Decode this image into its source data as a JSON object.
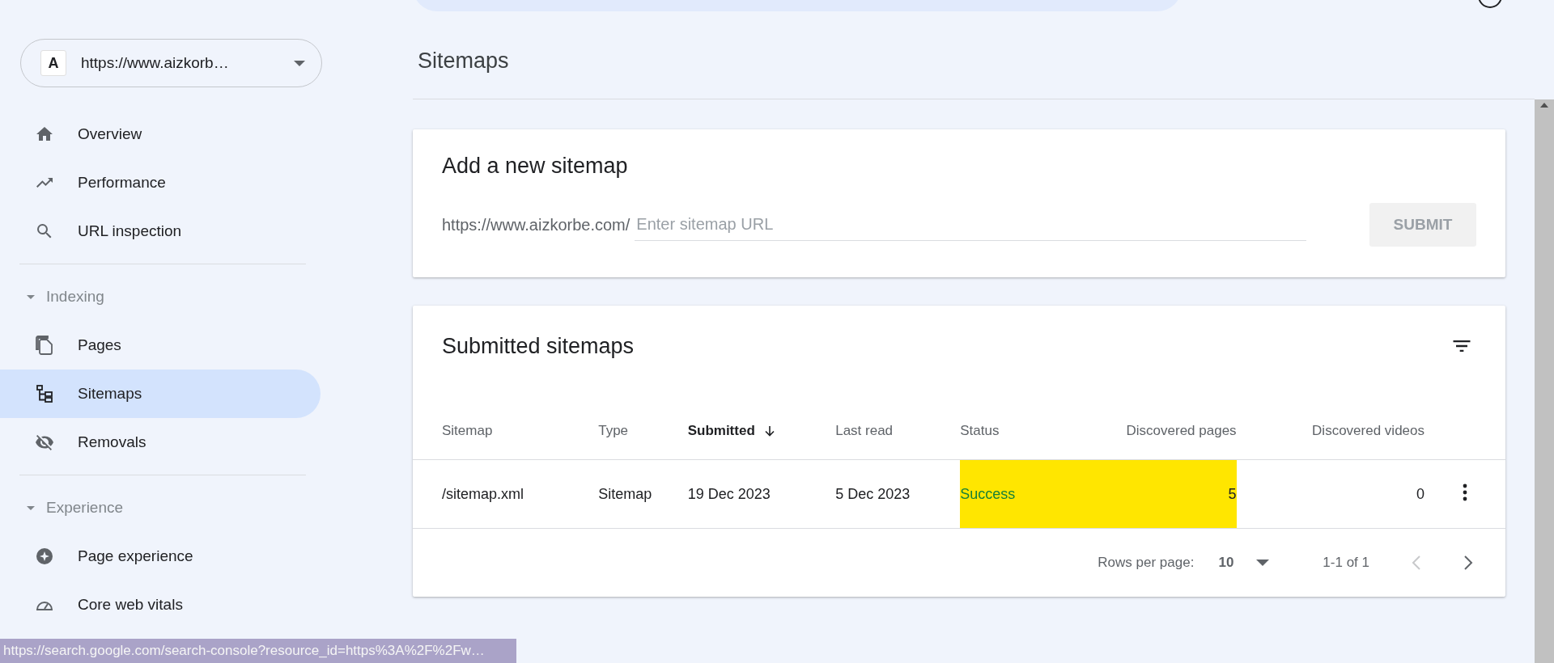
{
  "property": {
    "letter": "A",
    "url": "https://www.aizkorb…"
  },
  "sidebar": {
    "items": [
      {
        "label": "Overview",
        "selected": false
      },
      {
        "label": "Performance",
        "selected": false
      },
      {
        "label": "URL inspection",
        "selected": false
      }
    ],
    "groups": [
      {
        "label": "Indexing",
        "expanded": true,
        "items": [
          {
            "label": "Pages",
            "selected": false
          },
          {
            "label": "Sitemaps",
            "selected": true
          },
          {
            "label": "Removals",
            "selected": false
          }
        ]
      },
      {
        "label": "Experience",
        "expanded": true,
        "items": [
          {
            "label": "Page experience",
            "selected": false
          },
          {
            "label": "Core web vitals",
            "selected": false
          }
        ]
      }
    ]
  },
  "page_title": "Sitemaps",
  "add_card": {
    "title": "Add a new sitemap",
    "prefix": "https://www.aizkorbe.com/",
    "placeholder": "Enter sitemap URL",
    "button": {
      "label": "SUBMIT",
      "disabled": true
    }
  },
  "submitted_card": {
    "title": "Submitted sitemaps",
    "columns": [
      {
        "label": "Sitemap",
        "sorted": false,
        "kind": "text"
      },
      {
        "label": "Type",
        "sorted": false,
        "kind": "text"
      },
      {
        "label": "Submitted",
        "sorted": true,
        "kind": "text"
      },
      {
        "label": "Last read",
        "sorted": false,
        "kind": "text"
      },
      {
        "label": "Status",
        "sorted": false,
        "kind": "status"
      },
      {
        "label": "Discovered pages",
        "sorted": false,
        "kind": "number"
      },
      {
        "label": "Discovered videos",
        "sorted": false,
        "kind": "number"
      }
    ],
    "rows": [
      {
        "cells": [
          {
            "text": "/sitemap.xml",
            "highlighted": false
          },
          {
            "text": "Sitemap",
            "highlighted": false
          },
          {
            "text": "19 Dec 2023",
            "highlighted": false
          },
          {
            "text": "5 Dec 2023",
            "highlighted": false
          },
          {
            "text": "Success",
            "highlighted": true
          },
          {
            "text": "5",
            "highlighted": true
          },
          {
            "text": "0",
            "highlighted": false
          }
        ]
      }
    ],
    "pagination": {
      "rows_label": "Rows per page:",
      "rows_value": "10",
      "range": "1-1 of 1",
      "prev_disabled": true,
      "next_disabled": false
    }
  },
  "status_bar": "https://search.google.com/search-console?resource_id=https%3A%2F%2Fw…"
}
